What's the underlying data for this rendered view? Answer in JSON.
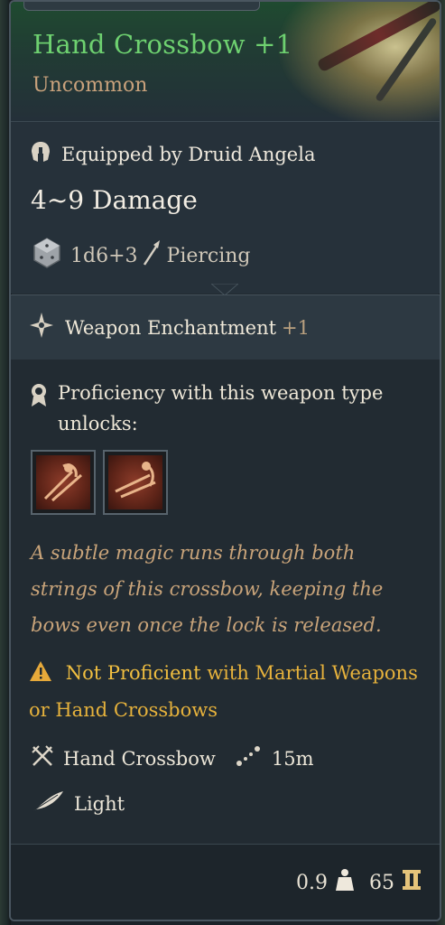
{
  "item": {
    "name": "Hand Crossbow +1",
    "rarity": "Uncommon"
  },
  "equipped": {
    "text": "Equipped by Druid Angela",
    "damage": "4~9 Damage",
    "dice": "1d6+3",
    "damage_type": "Piercing"
  },
  "enchantment": {
    "label": "Weapon Enchantment",
    "bonus": "+1"
  },
  "proficiency": {
    "text": "Proficiency with this weapon type unlocks:",
    "actions": [
      "action-1",
      "action-2"
    ]
  },
  "description": "A subtle magic runs through both strings of this crossbow, keeping the bows even once the lock is released.",
  "warning": {
    "strong": "Not Proficient",
    "rest": " with Martial Weapons or Hand Crossbows"
  },
  "properties": {
    "weapon_type": "Hand Crossbow",
    "range": "15m",
    "weight_class": "Light"
  },
  "footer": {
    "weight": "0.9",
    "value": "65"
  },
  "colors": {
    "name": "#6ed170",
    "rarity": "#c9a27c",
    "description": "#c9a47a",
    "warning": "#e6b23c"
  },
  "icons": {
    "equipped": "helmet-icon",
    "dice": "dice-icon",
    "piercing": "arrow-icon",
    "enchant": "enchant-icon",
    "proficiency": "badge-icon",
    "warning": "warning-icon",
    "weapon_type": "crossed-swords-icon",
    "range": "range-icon",
    "light": "feather-icon",
    "weight": "weight-icon",
    "gold": "gold-icon"
  }
}
